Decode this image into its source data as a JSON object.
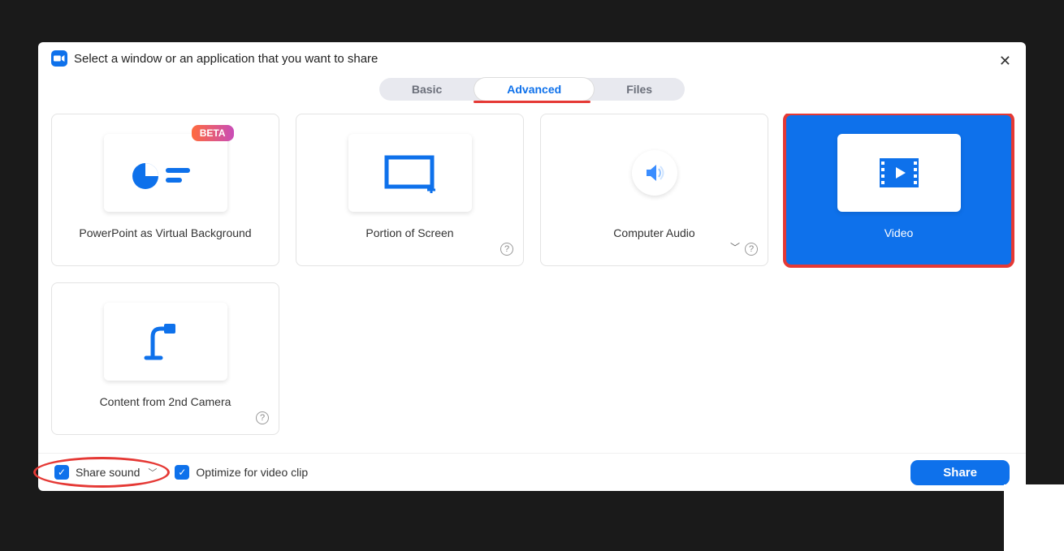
{
  "dialog": {
    "title": "Select a window or an application that you want to share"
  },
  "tabs": {
    "basic": "Basic",
    "advanced": "Advanced",
    "files": "Files",
    "active": "Advanced"
  },
  "cards": {
    "ppt": {
      "label": "PowerPoint as Virtual Background",
      "badge": "BETA"
    },
    "portion": {
      "label": "Portion of Screen"
    },
    "audio": {
      "label": "Computer Audio"
    },
    "video": {
      "label": "Video",
      "selected": true
    },
    "camera2": {
      "label": "Content from 2nd Camera"
    }
  },
  "footer": {
    "share_sound": "Share sound",
    "optimize": "Optimize for video clip",
    "share_button": "Share"
  }
}
